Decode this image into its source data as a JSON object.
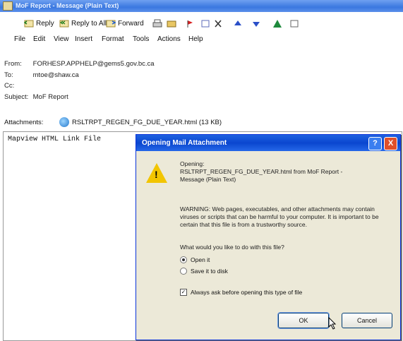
{
  "window": {
    "title": "MoF Report - Message (Plain Text)"
  },
  "toolbar": {
    "reply": "Reply",
    "reply_all": "Reply to All",
    "forward": "Forward"
  },
  "menu": [
    "File",
    "Edit",
    "View",
    "Insert",
    "Format",
    "Tools",
    "Actions",
    "Help"
  ],
  "header": {
    "from_label": "From:",
    "from_value": "FORHESP.APPHELP@gems5.gov.bc.ca",
    "to_label": "To:",
    "to_value": "mtoe@shaw.ca",
    "cc_label": "Cc:",
    "cc_value": "",
    "subject_label": "Subject:",
    "subject_value": "MoF Report",
    "attachments_label": "Attachments:",
    "attachment_file": "RSLTRPT_REGEN_FG_DUE_YEAR.html (13 KB)"
  },
  "body": {
    "text": "Mapview HTML Link File"
  },
  "dialog": {
    "title": "Opening Mail Attachment",
    "opening_label": "Opening:",
    "opening_file": "RSLTRPT_REGEN_FG_DUE_YEAR.html from MoF Report -",
    "opening_msg": "Message (Plain Text)",
    "warning": "WARNING: Web pages, executables, and other attachments may contain viruses or scripts that can be harmful to your computer. It is important to be certain that this file is from a trustworthy source.",
    "question": "What would you like to do with this file?",
    "option_open": "Open it",
    "option_save": "Save it to disk",
    "always_ask": "Always ask before opening this type of file",
    "ok": "OK",
    "cancel": "Cancel",
    "help_glyph": "?",
    "close_glyph": "X"
  }
}
